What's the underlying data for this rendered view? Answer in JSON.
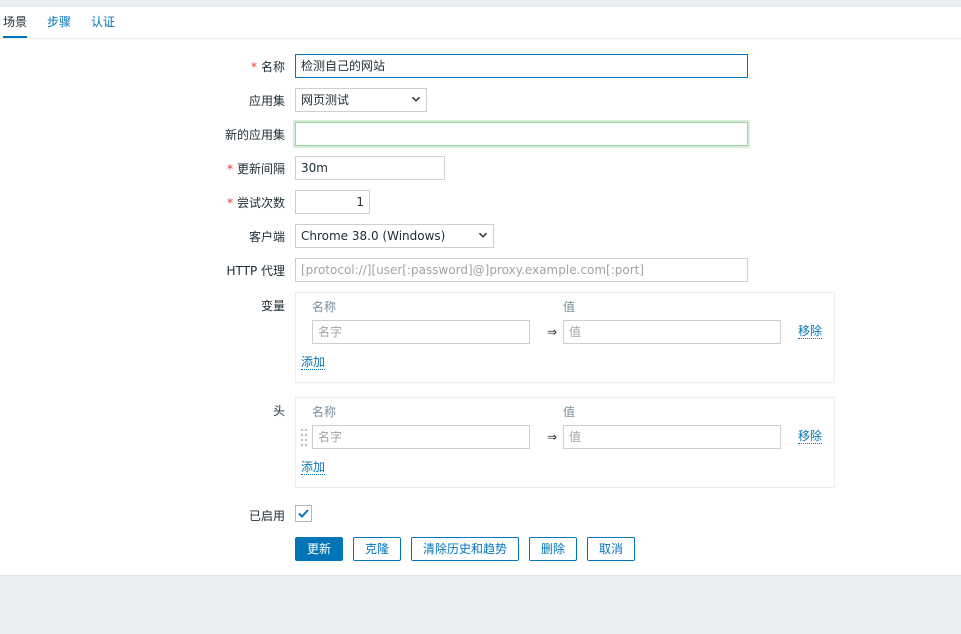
{
  "tabs": [
    "场景",
    "步骤",
    "认证"
  ],
  "form": {
    "name": {
      "label": "名称",
      "value": "检测自己的网站"
    },
    "application": {
      "label": "应用集",
      "value": "网页测试"
    },
    "new_application": {
      "label": "新的应用集",
      "value": ""
    },
    "update_interval": {
      "label": "更新间隔",
      "value": "30m"
    },
    "attempts": {
      "label": "尝试次数",
      "value": "1"
    },
    "agent": {
      "label": "客户端",
      "value": "Chrome 38.0 (Windows)"
    },
    "http_proxy": {
      "label": "HTTP 代理",
      "placeholder": "[protocol://][user[:password]@]proxy.example.com[:port]"
    },
    "variables": {
      "label": "变量",
      "col_name": "名称",
      "col_value": "值",
      "name_placeholder": "名字",
      "value_placeholder": "值",
      "arrow": "⇒",
      "remove": "移除",
      "add": "添加"
    },
    "headers": {
      "label": "头",
      "col_name": "名称",
      "col_value": "值",
      "name_placeholder": "名字",
      "value_placeholder": "值",
      "arrow": "⇒",
      "remove": "移除",
      "add": "添加"
    },
    "enabled": {
      "label": "已启用",
      "checked": true
    }
  },
  "buttons": {
    "update": "更新",
    "clone": "克隆",
    "clear": "清除历史和趋势",
    "delete": "删除",
    "cancel": "取消"
  },
  "colors": {
    "accent": "#0275b8",
    "required": "#e33734",
    "focus_green": "#9fd5a3"
  }
}
